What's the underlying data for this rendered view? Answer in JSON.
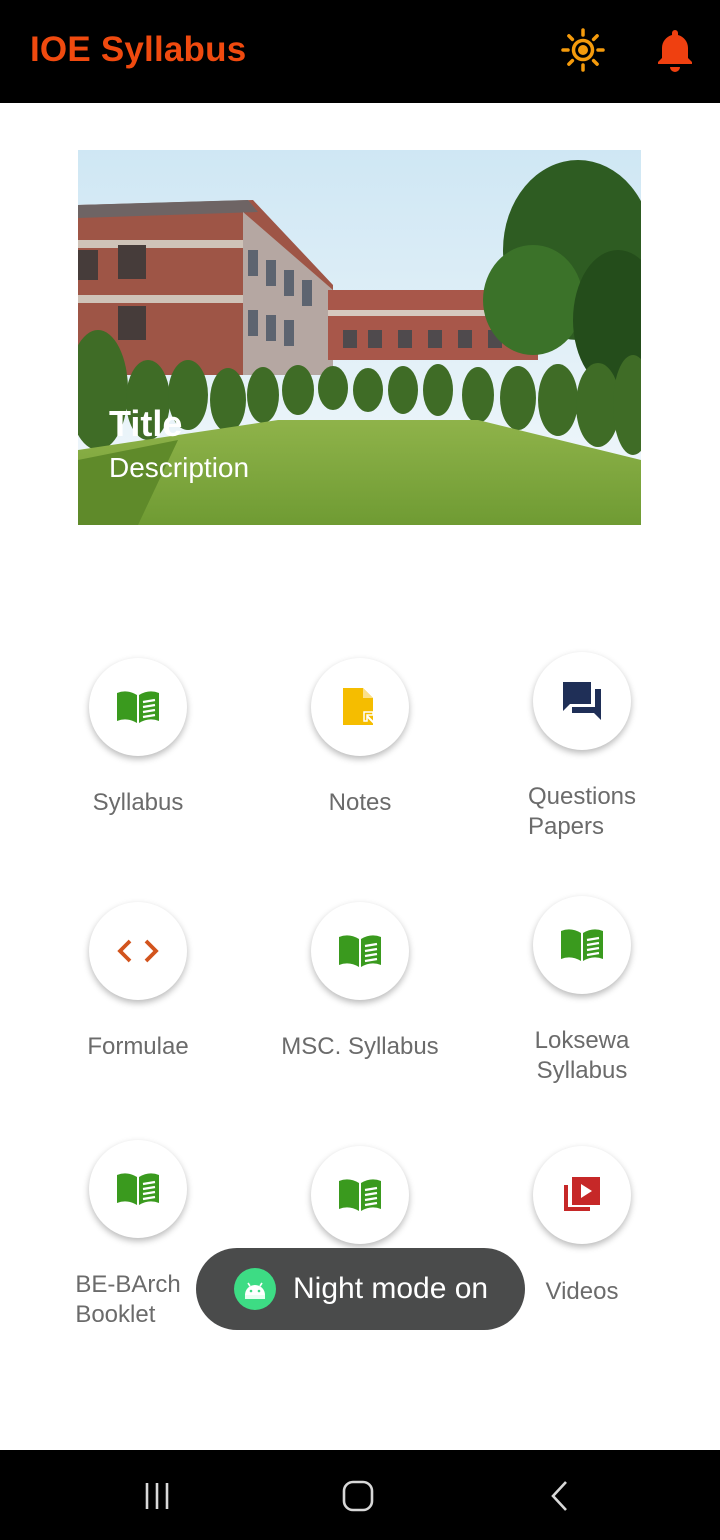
{
  "app": {
    "title": "IOE Syllabus"
  },
  "toolbar": {
    "theme_icon": "sun-icon",
    "notification_icon": "bell-icon"
  },
  "banner": {
    "title": "Title",
    "description": "Description"
  },
  "menu": {
    "items": [
      {
        "label": "Syllabus",
        "icon": "book-icon",
        "color": "#3a9a1e"
      },
      {
        "label": "Notes",
        "icon": "document-icon",
        "color": "#f5bd00"
      },
      {
        "label": "Questions\nPapers",
        "icon": "forum-icon",
        "color": "#1f2f57"
      },
      {
        "label": "Formulae",
        "icon": "code-icon",
        "color": "#d2541d"
      },
      {
        "label": "MSC. Syllabus",
        "icon": "book-icon",
        "color": "#3a9a1e"
      },
      {
        "label": "Loksewa\nSyllabus",
        "icon": "book-icon",
        "color": "#3a9a1e"
      },
      {
        "label": "BE-BArch\nBooklet",
        "icon": "book-icon",
        "color": "#3a9a1e"
      },
      {
        "label": "",
        "icon": "book-icon",
        "color": "#3a9a1e"
      },
      {
        "label": "Videos",
        "icon": "video-library-icon",
        "color": "#c62828"
      }
    ]
  },
  "toast": {
    "message": "Night mode on",
    "icon": "android-icon"
  },
  "colors": {
    "accent": "#f04a0f",
    "appbar": "#000000",
    "toast": "#4a4b4b"
  },
  "navigation": {
    "recents": "recents-icon",
    "home": "home-icon",
    "back": "back-icon"
  }
}
